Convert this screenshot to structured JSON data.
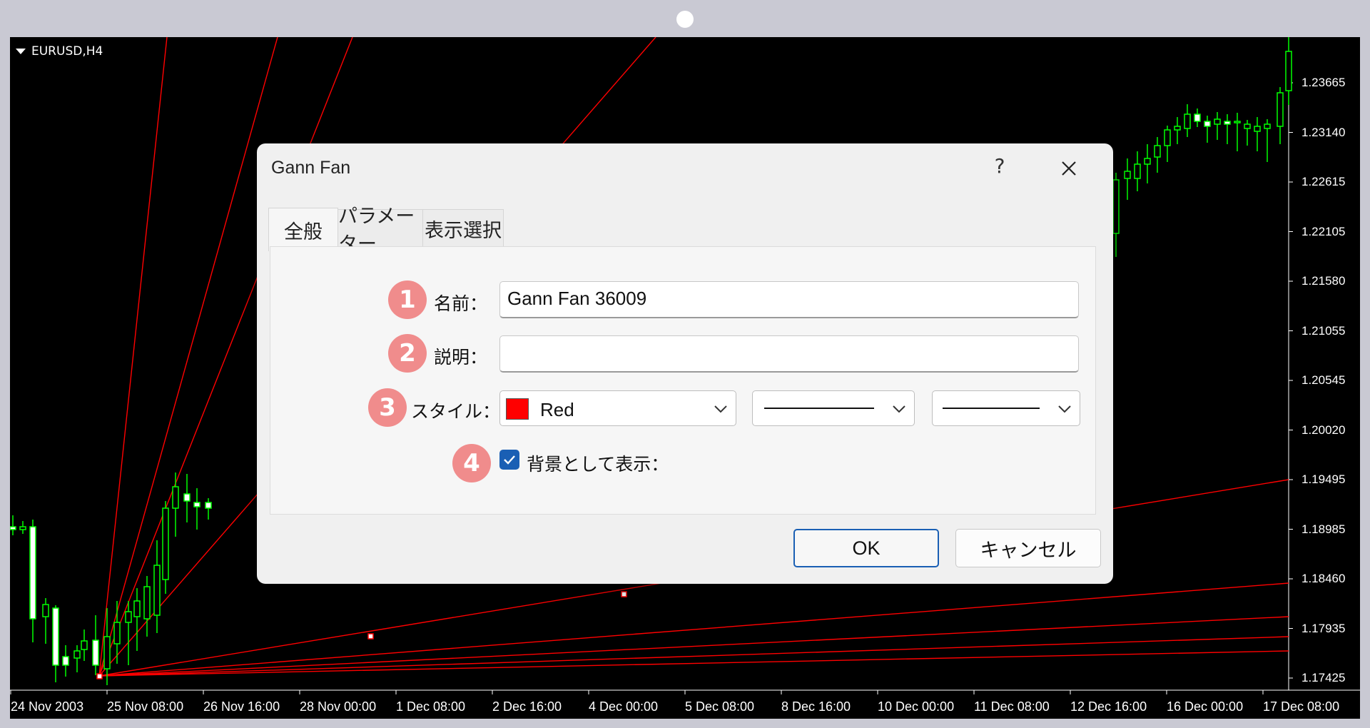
{
  "chart": {
    "symbol": "EURUSD,H4",
    "price_labels": [
      "1.23665",
      "1.23140",
      "1.22615",
      "1.22105",
      "1.21580",
      "1.21055",
      "1.20545",
      "1.20020",
      "1.19495",
      "1.18985",
      "1.18460",
      "1.17935",
      "1.17425"
    ],
    "date_labels": [
      "24 Nov 2003",
      "25 Nov 08:00",
      "26 Nov 16:00",
      "28 Nov 00:00",
      "1 Dec 08:00",
      "2 Dec 16:00",
      "4 Dec 00:00",
      "5 Dec 08:00",
      "8 Dec 16:00",
      "10 Dec 00:00",
      "11 Dec 08:00",
      "12 Dec 16:00",
      "16 Dec 00:00",
      "17 Dec 08:00"
    ],
    "colors": {
      "background": "#000000",
      "bull_candle": "#00ff00",
      "fan_lines": "#ff0000",
      "text": "#ffffff"
    }
  },
  "dialog": {
    "title": "Gann Fan",
    "help_label": "?",
    "close_icon": "close-icon",
    "tabs": [
      {
        "label": "全般",
        "active": true
      },
      {
        "label": "パラメーター",
        "active": false
      },
      {
        "label": "表示選択",
        "active": false
      }
    ],
    "fields": {
      "name": {
        "badge": "1",
        "label": "名前：",
        "value": "Gann Fan 36009"
      },
      "description": {
        "badge": "2",
        "label": "説明：",
        "value": ""
      },
      "style": {
        "badge": "3",
        "label": "スタイル：",
        "color_name": "Red",
        "color_hex": "#ff0000"
      },
      "background": {
        "badge": "4",
        "label": "背景として表示：",
        "checked": true
      }
    },
    "ok_label": "OK",
    "cancel_label": "キャンセル"
  }
}
